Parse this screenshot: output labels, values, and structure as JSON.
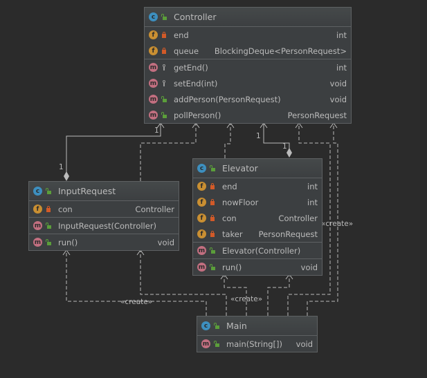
{
  "classes": [
    {
      "id": "controller",
      "name": "Controller",
      "fields": [
        {
          "name": "end",
          "type": "int",
          "vis": "private"
        },
        {
          "name": "queue",
          "type": "BlockingDeque<PersonRequest>",
          "vis": "private"
        }
      ],
      "ctors": [],
      "methods": [
        {
          "name": "getEnd()",
          "type": "int",
          "vis": "package"
        },
        {
          "name": "setEnd(int)",
          "type": "void",
          "vis": "package"
        },
        {
          "name": "addPerson(PersonRequest)",
          "type": "void",
          "vis": "public"
        },
        {
          "name": "pollPerson()",
          "type": "PersonRequest",
          "vis": "public"
        }
      ]
    },
    {
      "id": "elevator",
      "name": "Elevator",
      "fields": [
        {
          "name": "end",
          "type": "int",
          "vis": "private"
        },
        {
          "name": "nowFloor",
          "type": "int",
          "vis": "private"
        },
        {
          "name": "con",
          "type": "Controller",
          "vis": "private"
        },
        {
          "name": "taker",
          "type": "PersonRequest",
          "vis": "private"
        }
      ],
      "ctors": [
        {
          "name": "Elevator(Controller)",
          "type": "",
          "vis": "public"
        }
      ],
      "methods": [
        {
          "name": "run()",
          "type": "void",
          "vis": "public"
        }
      ]
    },
    {
      "id": "inputrequest",
      "name": "InputRequest",
      "fields": [
        {
          "name": "con",
          "type": "Controller",
          "vis": "private"
        }
      ],
      "ctors": [
        {
          "name": "InputRequest(Controller)",
          "type": "",
          "vis": "public"
        }
      ],
      "methods": [
        {
          "name": "run()",
          "type": "void",
          "vis": "public"
        }
      ]
    },
    {
      "id": "main",
      "name": "Main",
      "fields": [],
      "ctors": [],
      "methods": [
        {
          "name": "main(String[])",
          "type": "void",
          "vis": "public"
        }
      ]
    }
  ],
  "labels": {
    "mult_ctrl_input_a": "1",
    "mult_ctrl_input_b": "1",
    "mult_ctrl_elev_a": "1",
    "mult_ctrl_elev_b": "1",
    "create_input": "«create»",
    "create_elevator": "«create»",
    "create_controller": "«create»"
  },
  "icons": {
    "class": "c",
    "field": "f",
    "method": "m"
  },
  "colors": {
    "background": "#2b2b2b",
    "box": "#3c3f41",
    "class_icon": "#3d8fbf",
    "field_icon": "#c98f32",
    "method_icon": "#c26f80",
    "private": "#d25a28",
    "public": "#5b9e3a"
  }
}
